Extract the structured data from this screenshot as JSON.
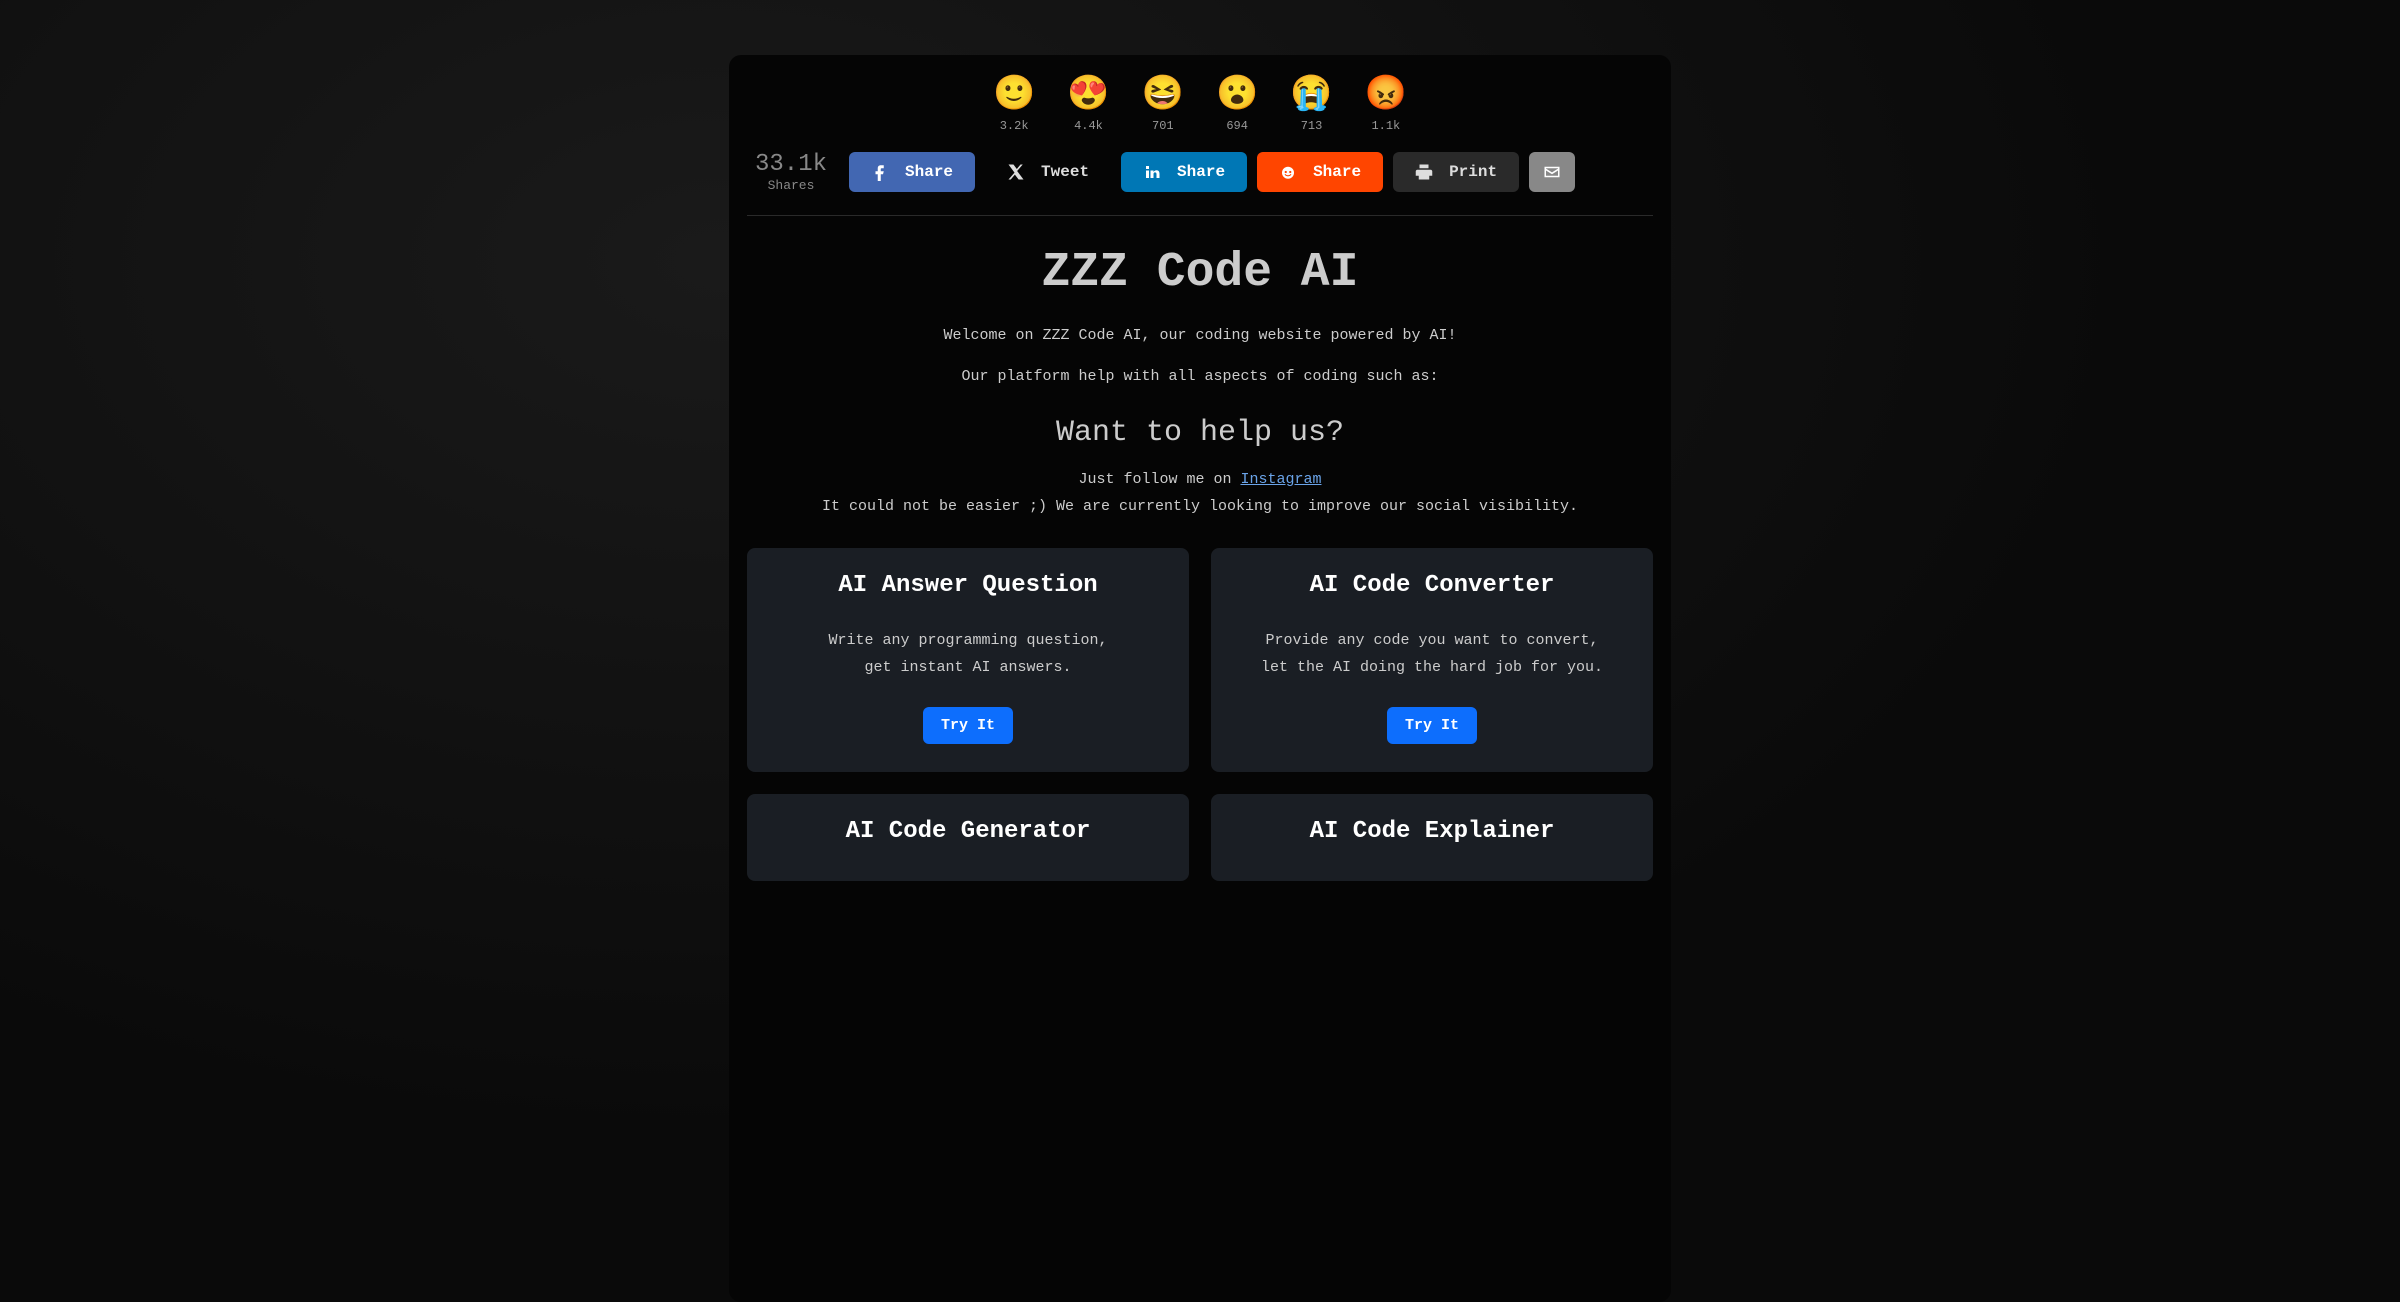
{
  "reactions": [
    {
      "emoji": "🙂",
      "count": "3.2k"
    },
    {
      "emoji": "😍",
      "count": "4.4k"
    },
    {
      "emoji": "😆",
      "count": "701"
    },
    {
      "emoji": "😮",
      "count": "694"
    },
    {
      "emoji": "😭",
      "count": "713"
    },
    {
      "emoji": "😡",
      "count": "1.1k"
    }
  ],
  "sharesTotal": {
    "num": "33.1k",
    "label": "Shares"
  },
  "shareButtons": {
    "facebook": "Share",
    "twitter": "Tweet",
    "linkedin": "Share",
    "reddit": "Share",
    "print": "Print"
  },
  "hero": {
    "title": "ZZZ Code AI",
    "subhead1": "Welcome on ZZZ Code AI, our coding website powered by AI!",
    "subhead2": "Our platform help with all aspects of coding such as:",
    "help_title": "Want to help us?",
    "help_text1a": "Just follow me on ",
    "help_link": "Instagram",
    "help_text2": "It could not be easier ;) We are currently looking to improve our social visibility."
  },
  "cards": [
    {
      "title": "AI Answer Question",
      "desc": "Write any programming question,\nget instant AI answers.",
      "cta": "Try It"
    },
    {
      "title": "AI Code Converter",
      "desc": "Provide any code you want to convert,\nlet the AI doing the hard job for you.",
      "cta": "Try It"
    },
    {
      "title": "AI Code Generator",
      "desc": "",
      "cta": ""
    },
    {
      "title": "AI Code Explainer",
      "desc": "",
      "cta": ""
    }
  ]
}
